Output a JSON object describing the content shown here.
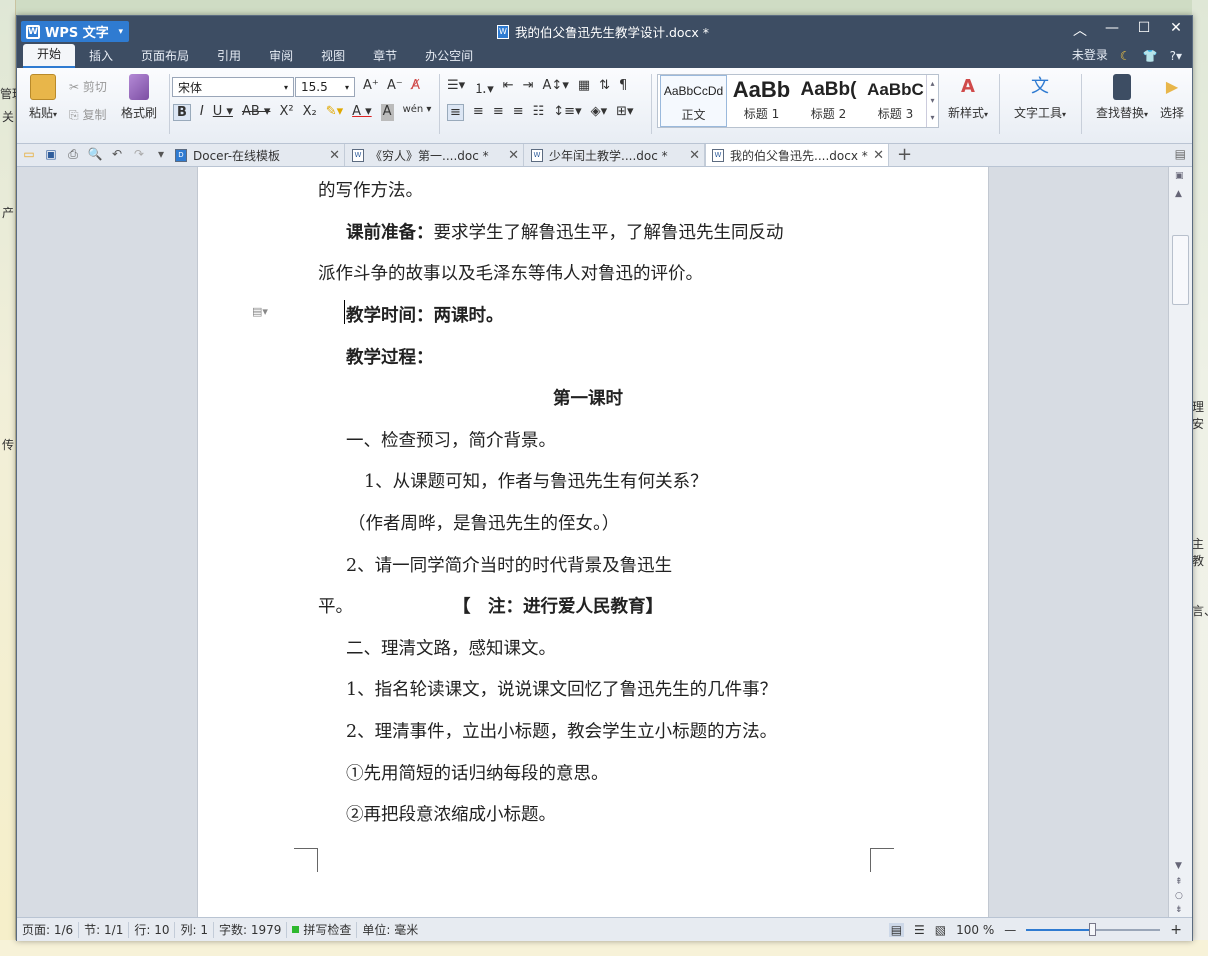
{
  "window": {
    "app_name": "WPS 文字",
    "doc_title": "我的伯父鲁迅先生教学设计.docx *"
  },
  "menu": {
    "tabs": [
      "开始",
      "插入",
      "页面布局",
      "引用",
      "审阅",
      "视图",
      "章节",
      "办公空间"
    ],
    "active": 0,
    "login": "未登录"
  },
  "ribbon": {
    "paste": "粘贴",
    "cut": "剪切",
    "copy": "复制",
    "format_painter": "格式刷",
    "font_name": "宋体",
    "font_size": "15.5",
    "styles": [
      {
        "preview": "AaBbCcDd",
        "label": "正文"
      },
      {
        "preview": "AaBb",
        "label": "标题 1"
      },
      {
        "preview": "AaBb(",
        "label": "标题 2"
      },
      {
        "preview": "AaBbC",
        "label": "标题 3"
      }
    ],
    "new_style": "新样式",
    "text_tools": "文字工具",
    "find_replace": "查找替换",
    "select": "选择"
  },
  "doc_tabs": [
    {
      "label": "Docer-在线模板"
    },
    {
      "label": "《穷人》第一....doc *"
    },
    {
      "label": "少年闰土教学....doc *"
    },
    {
      "label": "我的伯父鲁迅先....docx *"
    }
  ],
  "document": {
    "lines": [
      "的写作方法。",
      "课前准备：",
      "要求学生了解鲁迅生平，了解鲁迅先生同反动",
      "派作斗争的故事以及毛泽东等伟人对鲁迅的评价。",
      "教学时间：两课时。",
      "教学过程：",
      "第一课时",
      "一、检查预习，简介背景。",
      "1、从课题可知，作者与鲁迅先生有何关系？",
      "（作者周晔，是鲁迅先生的侄女。）",
      "2、请一同学简介当时的时代背景及鲁迅生",
      "平。",
      "【　注：进行爱人民教育】",
      "二、理清文路，感知课文。",
      "1、指名轮读课文，说说课文回忆了鲁迅先生的几件事？",
      "2、理清事件，立出小标题，教会学生立小标题的方法。",
      "①先用简短的话归纳每段的意思。",
      "②再把段意浓缩成小标题。"
    ]
  },
  "status": {
    "page": "页面: 1/6",
    "section": "节: 1/1",
    "row": "行: 10",
    "col": "列: 1",
    "words": "字数: 1979",
    "spell": "拼写检查",
    "unit": "单位: 毫米",
    "zoom": "100 %"
  },
  "desktop": {
    "frags": [
      "管理",
      "关",
      "产",
      "传",
      "理安",
      "主教",
      "言、"
    ]
  },
  "colors": {
    "accent": "#2f7bd1",
    "titlebar": "#3d4d63"
  }
}
